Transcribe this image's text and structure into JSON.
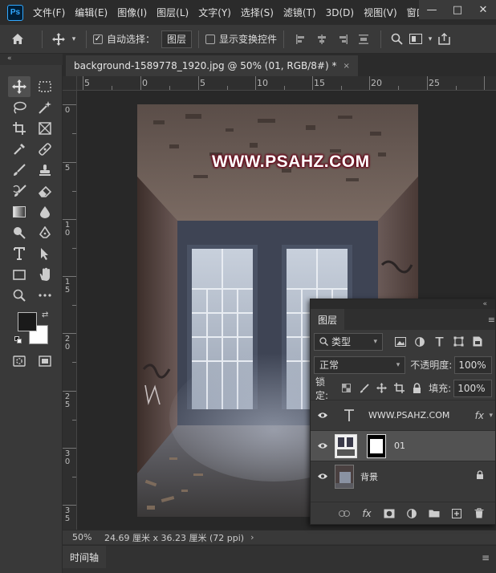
{
  "app": {
    "logo": "Ps"
  },
  "menu": [
    "文件(F)",
    "编辑(E)",
    "图像(I)",
    "图层(L)",
    "文字(Y)",
    "选择(S)",
    "滤镜(T)",
    "3D(D)",
    "视图(V)",
    "窗口"
  ],
  "window_controls": {
    "minimize": "—",
    "maximize": "□",
    "close": "✕"
  },
  "options_bar": {
    "auto_select_label": "自动选择：",
    "auto_select_checked": true,
    "auto_select_target": "图层",
    "show_transform_label": "显示变换控件",
    "show_transform_checked": false
  },
  "toolbar": {
    "collapse": "«"
  },
  "document": {
    "tab_title": "background-1589778_1920.jpg @ 50% (01, RGB/8#) *",
    "close": "×",
    "watermark_text": "WWW.PSAHZ.COM"
  },
  "rulers": {
    "h_labels": [
      "5",
      "0",
      "5",
      "10",
      "15",
      "20",
      "25"
    ],
    "v_labels": [
      "0",
      "5",
      "10",
      "15",
      "20",
      "25",
      "30",
      "35"
    ]
  },
  "status": {
    "zoom": "50%",
    "info": "24.69 厘米 x 36.23 厘米 (72 ppi)",
    "arrow": "›"
  },
  "timeline": {
    "label": "时间轴",
    "menu": "≡"
  },
  "layers_panel": {
    "collapse": "«",
    "tab": "图层",
    "menu": "≡",
    "filter_label": "类型",
    "blend_mode": "正常",
    "opacity_label": "不透明度:",
    "opacity_value": "100%",
    "lock_label": "锁定:",
    "fill_label": "填充:",
    "fill_value": "100%",
    "layers": [
      {
        "name": "WWW.PSAHZ.COM",
        "type": "text",
        "fx": "fx",
        "visible": true,
        "selected": false
      },
      {
        "name": "01",
        "type": "masked",
        "visible": true,
        "selected": true
      },
      {
        "name": "背景",
        "type": "background",
        "visible": true,
        "locked": true,
        "selected": false
      }
    ]
  },
  "colors": {
    "accent": "#31a8ff",
    "watermark_outline": "#6a1020",
    "panel_bg": "#393939",
    "canvas_bg": "#282828"
  }
}
